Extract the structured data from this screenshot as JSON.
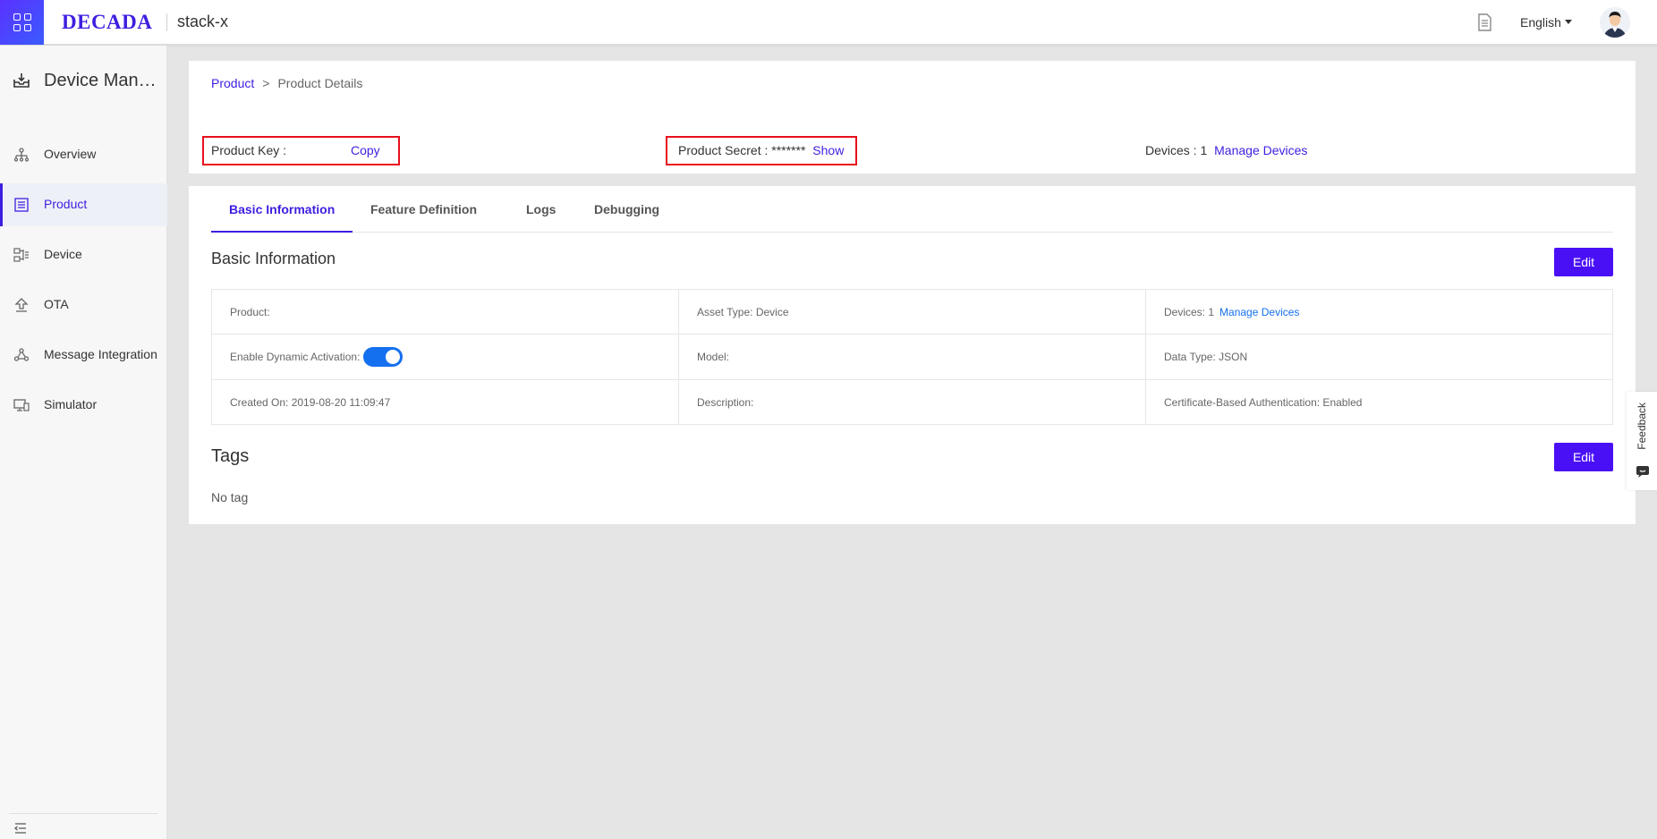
{
  "topbar": {
    "logo": "DECADA",
    "workspace": "stack-x",
    "language": "English",
    "icons": {
      "apps": "apps-grid-icon",
      "docs": "document-icon",
      "avatar": "user-avatar"
    }
  },
  "sidebar": {
    "title": "Device Management",
    "items": [
      {
        "label": "Overview",
        "icon": "hierarchy-icon"
      },
      {
        "label": "Product",
        "icon": "product-list-icon",
        "active": true
      },
      {
        "label": "Device",
        "icon": "device-icon"
      },
      {
        "label": "OTA",
        "icon": "upload-icon"
      },
      {
        "label": "Message Integration",
        "icon": "integration-icon"
      },
      {
        "label": "Simulator",
        "icon": "simulator-icon"
      }
    ]
  },
  "breadcrumb": {
    "root": "Product",
    "separator": ">",
    "current": "Product Details"
  },
  "header": {
    "product_key_label": "Product Key :",
    "copy_label": "Copy",
    "product_secret_label": "Product Secret : *******",
    "show_label": "Show",
    "devices_label": "Devices : 1",
    "manage_devices_label": "Manage Devices"
  },
  "tabs": [
    "Basic Information",
    "Feature Definition",
    "Logs",
    "Debugging"
  ],
  "basic_info": {
    "title": "Basic Information",
    "edit_label": "Edit",
    "product": "Product:",
    "asset_type": "Asset Type: Device",
    "devices": "Devices: 1",
    "manage_devices": "Manage Devices",
    "dynamic_activation": "Enable Dynamic Activation:",
    "dynamic_activation_enabled": true,
    "model": "Model:",
    "data_type": "Data Type: JSON",
    "created_on": "Created On: 2019-08-20 11:09:47",
    "description": "Description:",
    "cert_auth": "Certificate-Based Authentication: Enabled"
  },
  "tags": {
    "title": "Tags",
    "edit_label": "Edit",
    "empty": "No tag"
  },
  "feedback": {
    "label": "Feedback"
  },
  "colors": {
    "accent": "#3d1fe0",
    "button": "#4a10f5",
    "link": "#1570ef",
    "highlight": "#e8101e"
  }
}
